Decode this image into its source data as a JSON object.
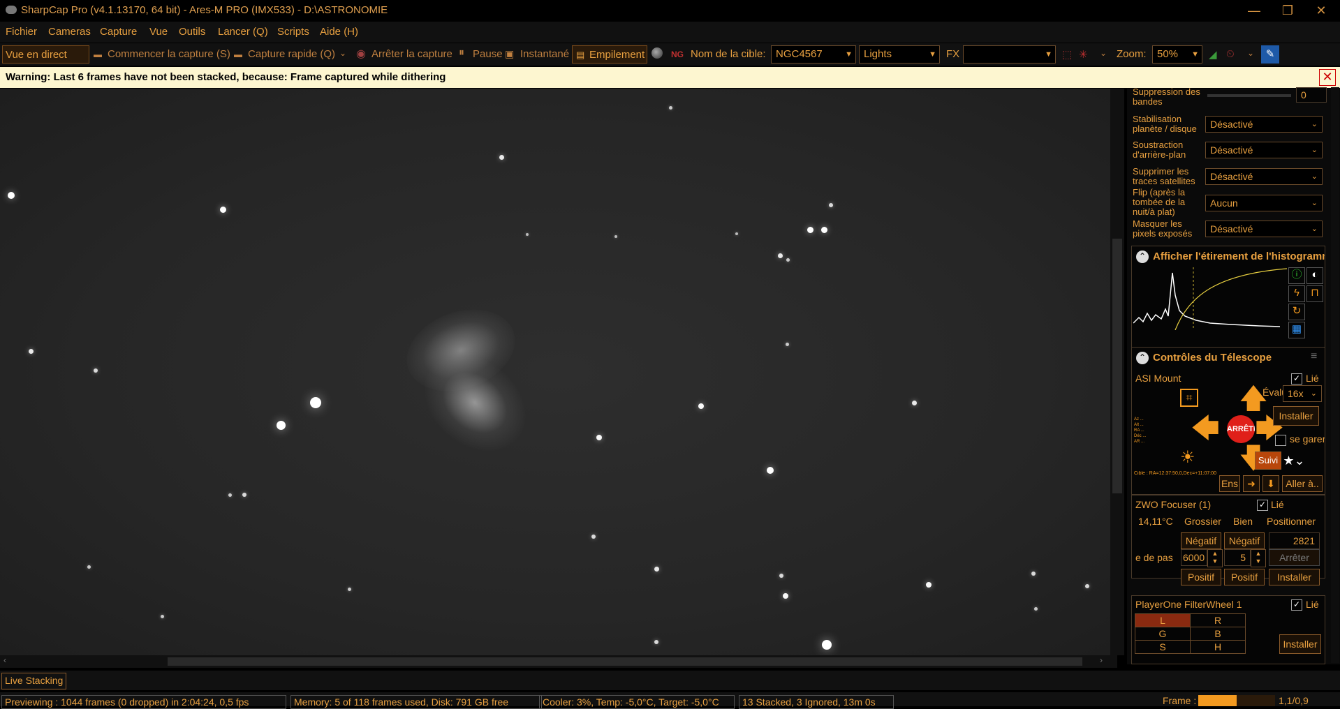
{
  "window": {
    "title": "SharpCap Pro (v4.1.13170, 64 bit) - Ares-M PRO (IMX533) - D:\\ASTRONOMIE",
    "minimize": "—",
    "restore": "❐",
    "close": "✕"
  },
  "menu": [
    "Fichier",
    "Cameras",
    "Capture",
    "Vue",
    "Outils",
    "Lancer (Q)",
    "Scripts",
    "Aide (H)"
  ],
  "toolbar": {
    "live_view": "Vue en direct (W)",
    "start_capture": "Commencer la capture (S)",
    "quick_capture": "Capture rapide (Q)",
    "stop_capture": "Arrêter la capture",
    "pause": "Pause",
    "snapshot": "Instantané",
    "stacking": "Empilement",
    "target_label": "Nom de la cible:",
    "target_value": "NGC4567",
    "frame_type": "Lights",
    "fx_label": "FX",
    "fx_value": "",
    "zoom_label": "Zoom:",
    "zoom_value": "50%"
  },
  "warning": {
    "message": "Warning: Last 6 frames have not been stacked, because: Frame captured while dithering",
    "close": "✕"
  },
  "panel": {
    "settings": [
      {
        "label": "Suppression des bandes",
        "value": "0"
      },
      {
        "label": "Stabilisation planète / disque",
        "value": "Désactivé"
      },
      {
        "label": "Soustraction d'arrière-plan",
        "value": "Désactivé"
      },
      {
        "label": "Supprimer les traces satellites",
        "value": "Désactivé"
      },
      {
        "label": "Flip (après la tombée de la nuit/à plat)",
        "value": "Aucun"
      },
      {
        "label": "Masquer les pixels exposés",
        "value": "Désactivé"
      }
    ],
    "histogram_title": "Afficher l'étirement de l'histogramm",
    "telescope": {
      "title": "Contrôles du Télescope",
      "mount": "ASI Mount",
      "linked": "Lié",
      "rate_label": "Évaluer:",
      "rate_value": "16x",
      "install": "Installer",
      "park": "se garer",
      "stop": "ARRÊTE",
      "tracking": "Suivi",
      "set": "Ens",
      "goto": "Aller à..",
      "target_line": "Cible : RA=12:37:50,0,Dec=+11:07:00"
    },
    "focuser": {
      "title": "ZWO Focuser (1)",
      "linked": "Lié",
      "temp": "14,11°C",
      "coarse": "Grossier",
      "fine": "Bien",
      "position_label": "Positionner",
      "neg": "Négatif",
      "pos": "Positif",
      "position": "2821",
      "step_label": "e de pas",
      "coarse_step": "6000",
      "fine_step": "5",
      "stop": "Arrêter",
      "install": "Installer"
    },
    "filterwheel": {
      "title": "PlayerOne FilterWheel 1",
      "linked": "Lié",
      "filters": [
        "L",
        "R",
        "G",
        "B",
        "S",
        "H"
      ],
      "selected": "L",
      "install": "Installer"
    }
  },
  "live_stacking": "Live Stacking",
  "status": {
    "preview": "Previewing : 1044 frames (0 dropped) in 2:04:24, 0,5 fps",
    "memory": "Memory: 5 of 118 frames used, Disk: 791 GB free",
    "cooler": "Cooler: 3%, Temp: -5,0°C, Target: -5,0°C",
    "stacked": "13 Stacked, 3 Ignored, 13m 0s",
    "frame_label": "Frame :",
    "frame_value": "1,1/0,9"
  }
}
